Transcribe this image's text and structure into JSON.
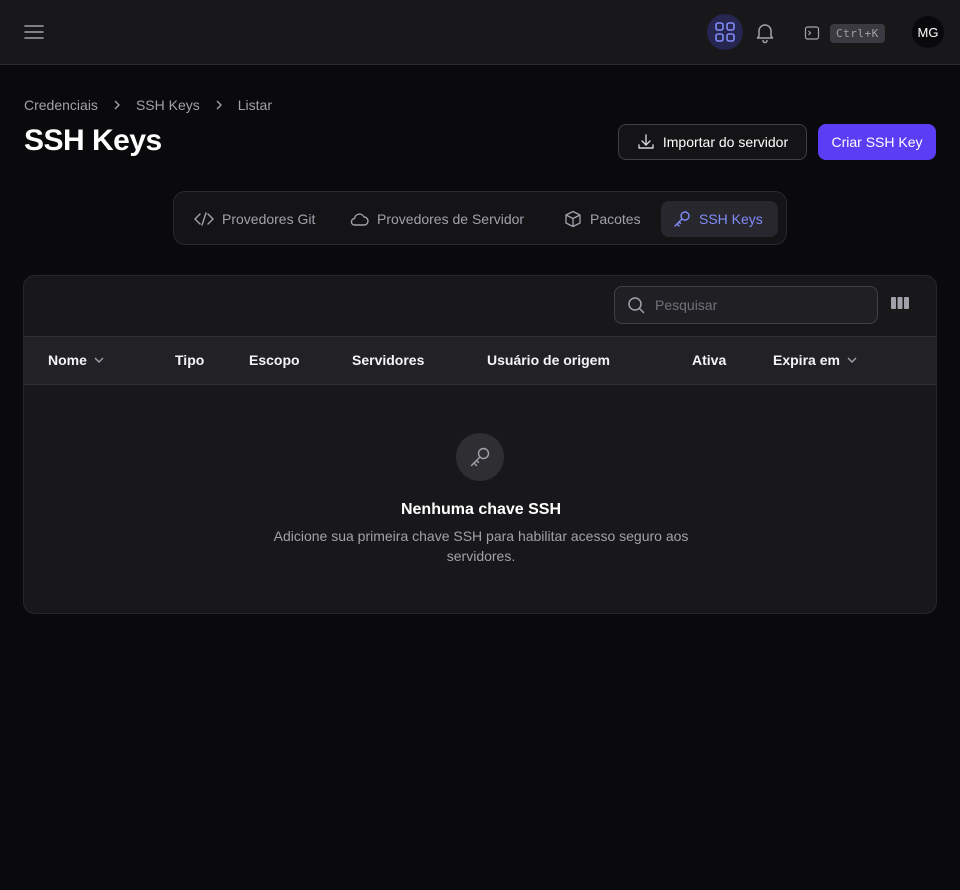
{
  "topbar": {
    "menu_icon": "hamburger-icon",
    "apps_icon": "apps-grid-icon",
    "bell_icon": "bell-icon",
    "terminal_icon": "terminal-icon",
    "shortcut": "Ctrl+K",
    "avatar_initials": "MG",
    "accent": "#818cf8"
  },
  "breadcrumb": [
    "Credenciais",
    "SSH Keys",
    "Listar"
  ],
  "page": {
    "title": "SSH Keys",
    "import_button": "Importar do servidor",
    "create_button": "Criar SSH Key",
    "primary_color": "#5b3df5"
  },
  "tabs": [
    {
      "label": "Provedores Git",
      "icon": "code-icon"
    },
    {
      "label": "Provedores de Servidor",
      "icon": "cloud-icon"
    },
    {
      "label": "Pacotes",
      "icon": "package-icon"
    },
    {
      "label": "SSH Keys",
      "icon": "key-icon",
      "active": true
    }
  ],
  "table": {
    "search_placeholder": "Pesquisar",
    "columns": [
      {
        "label": "Nome",
        "sortable": true
      },
      {
        "label": "Tipo"
      },
      {
        "label": "Escopo"
      },
      {
        "label": "Servidores"
      },
      {
        "label": "Usuário de origem"
      },
      {
        "label": "Ativa"
      },
      {
        "label": "Expira em",
        "sortable": true
      }
    ],
    "rows": []
  },
  "empty_state": {
    "icon": "key-icon",
    "title": "Nenhuma chave SSH",
    "description": "Adicione sua primeira chave SSH para habilitar acesso seguro aos servidores."
  }
}
